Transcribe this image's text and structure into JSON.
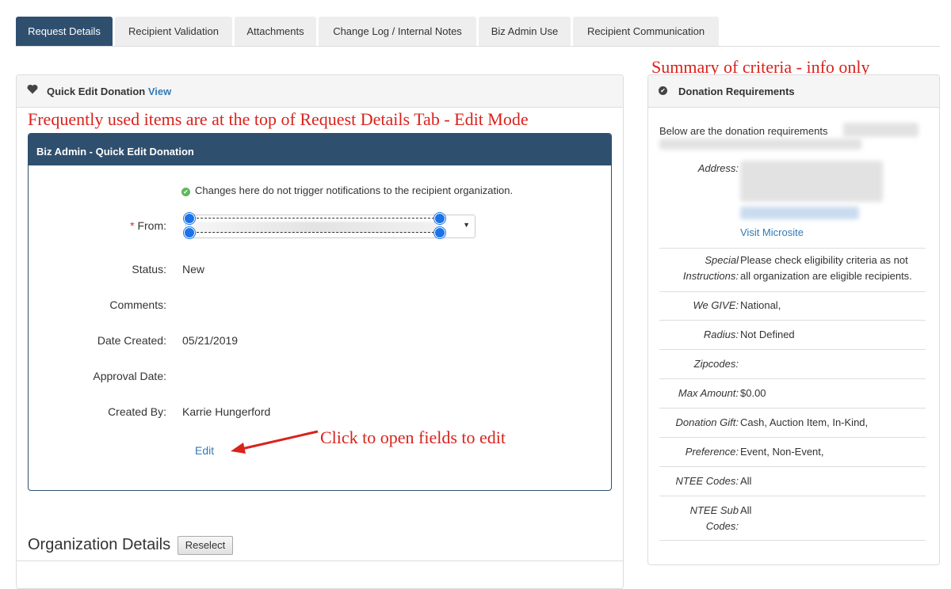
{
  "tabs": [
    {
      "label": "Request Details",
      "active": true
    },
    {
      "label": "Recipient Validation",
      "active": false
    },
    {
      "label": "Attachments",
      "active": false
    },
    {
      "label": "Change Log / Internal Notes",
      "active": false
    },
    {
      "label": "Biz Admin Use",
      "active": false
    },
    {
      "label": "Recipient Communication",
      "active": false
    }
  ],
  "annotations": {
    "summary": "Summary of criteria - info only",
    "frequently_used": "Frequently used items are at the top of Request Details Tab - Edit Mode",
    "click_to_open": "Click to open fields to edit"
  },
  "quick_edit": {
    "heading": "Quick Edit Donation",
    "view_link": "View",
    "heart_icon": "heart-icon",
    "inner_title": "Biz Admin - Quick Edit Donation",
    "notice": "Changes here do not trigger notifications to the recipient organization.",
    "notice_icon": "check-circle-icon",
    "from_label": "From:",
    "required_star": "*",
    "fields": [
      {
        "label": "Status:",
        "value": "New"
      },
      {
        "label": "Comments:",
        "value": ""
      },
      {
        "label": "Date Created:",
        "value": "05/21/2019"
      },
      {
        "label": "Approval Date:",
        "value": ""
      },
      {
        "label": "Created By:",
        "value": "Karrie Hungerford"
      }
    ],
    "edit_link": "Edit"
  },
  "organization": {
    "title": "Organization Details",
    "reselect": "Reselect"
  },
  "requirements": {
    "heading": "Donation Requirements",
    "intro": "Below are the donation requirements",
    "address_label": "Address:",
    "microsite_link": "Visit Microsite",
    "rows": [
      {
        "key_line1": "Special",
        "key_line2": "Instructions:",
        "val_line1": "Please check eligibility criteria as not",
        "val_line2": "all organization are eligible recipients."
      },
      {
        "key_line1": "We GIVE:",
        "val_line1": "National,"
      },
      {
        "key_line1": "Radius:",
        "val_line1": "Not Defined"
      },
      {
        "key_line1": "Zipcodes:",
        "val_line1": ""
      },
      {
        "key_line1": "Max Amount:",
        "val_line1": "$0.00"
      },
      {
        "key_line1": "Donation Gift:",
        "val_line1": "Cash, Auction Item, In-Kind,"
      },
      {
        "key_line1": "Preference:",
        "val_line1": "Event, Non-Event,"
      },
      {
        "key_line1": "NTEE Codes:",
        "val_line1": "All"
      },
      {
        "key_line1": "NTEE Sub",
        "key_line2": "Codes:",
        "val_line1": "All"
      }
    ]
  },
  "colors": {
    "accent_dark": "#2f4f6f",
    "link": "#337ab7",
    "annotation_red": "#d9221c",
    "success_green": "#5cb85c"
  }
}
